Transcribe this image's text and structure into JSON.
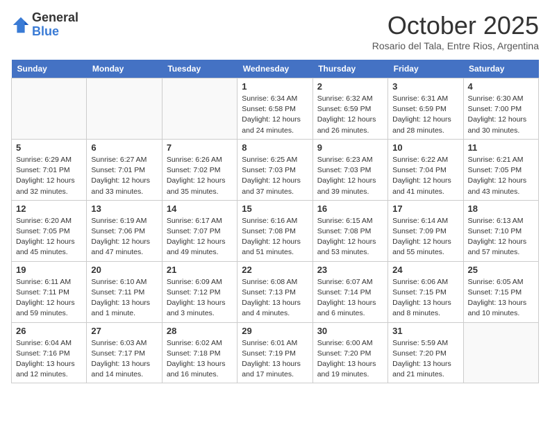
{
  "header": {
    "logo_line1": "General",
    "logo_line2": "Blue",
    "month": "October 2025",
    "location": "Rosario del Tala, Entre Rios, Argentina"
  },
  "days_of_week": [
    "Sunday",
    "Monday",
    "Tuesday",
    "Wednesday",
    "Thursday",
    "Friday",
    "Saturday"
  ],
  "weeks": [
    [
      {
        "day": "",
        "info": ""
      },
      {
        "day": "",
        "info": ""
      },
      {
        "day": "",
        "info": ""
      },
      {
        "day": "1",
        "info": "Sunrise: 6:34 AM\nSunset: 6:58 PM\nDaylight: 12 hours\nand 24 minutes."
      },
      {
        "day": "2",
        "info": "Sunrise: 6:32 AM\nSunset: 6:59 PM\nDaylight: 12 hours\nand 26 minutes."
      },
      {
        "day": "3",
        "info": "Sunrise: 6:31 AM\nSunset: 6:59 PM\nDaylight: 12 hours\nand 28 minutes."
      },
      {
        "day": "4",
        "info": "Sunrise: 6:30 AM\nSunset: 7:00 PM\nDaylight: 12 hours\nand 30 minutes."
      }
    ],
    [
      {
        "day": "5",
        "info": "Sunrise: 6:29 AM\nSunset: 7:01 PM\nDaylight: 12 hours\nand 32 minutes."
      },
      {
        "day": "6",
        "info": "Sunrise: 6:27 AM\nSunset: 7:01 PM\nDaylight: 12 hours\nand 33 minutes."
      },
      {
        "day": "7",
        "info": "Sunrise: 6:26 AM\nSunset: 7:02 PM\nDaylight: 12 hours\nand 35 minutes."
      },
      {
        "day": "8",
        "info": "Sunrise: 6:25 AM\nSunset: 7:03 PM\nDaylight: 12 hours\nand 37 minutes."
      },
      {
        "day": "9",
        "info": "Sunrise: 6:23 AM\nSunset: 7:03 PM\nDaylight: 12 hours\nand 39 minutes."
      },
      {
        "day": "10",
        "info": "Sunrise: 6:22 AM\nSunset: 7:04 PM\nDaylight: 12 hours\nand 41 minutes."
      },
      {
        "day": "11",
        "info": "Sunrise: 6:21 AM\nSunset: 7:05 PM\nDaylight: 12 hours\nand 43 minutes."
      }
    ],
    [
      {
        "day": "12",
        "info": "Sunrise: 6:20 AM\nSunset: 7:05 PM\nDaylight: 12 hours\nand 45 minutes."
      },
      {
        "day": "13",
        "info": "Sunrise: 6:19 AM\nSunset: 7:06 PM\nDaylight: 12 hours\nand 47 minutes."
      },
      {
        "day": "14",
        "info": "Sunrise: 6:17 AM\nSunset: 7:07 PM\nDaylight: 12 hours\nand 49 minutes."
      },
      {
        "day": "15",
        "info": "Sunrise: 6:16 AM\nSunset: 7:08 PM\nDaylight: 12 hours\nand 51 minutes."
      },
      {
        "day": "16",
        "info": "Sunrise: 6:15 AM\nSunset: 7:08 PM\nDaylight: 12 hours\nand 53 minutes."
      },
      {
        "day": "17",
        "info": "Sunrise: 6:14 AM\nSunset: 7:09 PM\nDaylight: 12 hours\nand 55 minutes."
      },
      {
        "day": "18",
        "info": "Sunrise: 6:13 AM\nSunset: 7:10 PM\nDaylight: 12 hours\nand 57 minutes."
      }
    ],
    [
      {
        "day": "19",
        "info": "Sunrise: 6:11 AM\nSunset: 7:11 PM\nDaylight: 12 hours\nand 59 minutes."
      },
      {
        "day": "20",
        "info": "Sunrise: 6:10 AM\nSunset: 7:11 PM\nDaylight: 13 hours\nand 1 minute."
      },
      {
        "day": "21",
        "info": "Sunrise: 6:09 AM\nSunset: 7:12 PM\nDaylight: 13 hours\nand 3 minutes."
      },
      {
        "day": "22",
        "info": "Sunrise: 6:08 AM\nSunset: 7:13 PM\nDaylight: 13 hours\nand 4 minutes."
      },
      {
        "day": "23",
        "info": "Sunrise: 6:07 AM\nSunset: 7:14 PM\nDaylight: 13 hours\nand 6 minutes."
      },
      {
        "day": "24",
        "info": "Sunrise: 6:06 AM\nSunset: 7:15 PM\nDaylight: 13 hours\nand 8 minutes."
      },
      {
        "day": "25",
        "info": "Sunrise: 6:05 AM\nSunset: 7:15 PM\nDaylight: 13 hours\nand 10 minutes."
      }
    ],
    [
      {
        "day": "26",
        "info": "Sunrise: 6:04 AM\nSunset: 7:16 PM\nDaylight: 13 hours\nand 12 minutes."
      },
      {
        "day": "27",
        "info": "Sunrise: 6:03 AM\nSunset: 7:17 PM\nDaylight: 13 hours\nand 14 minutes."
      },
      {
        "day": "28",
        "info": "Sunrise: 6:02 AM\nSunset: 7:18 PM\nDaylight: 13 hours\nand 16 minutes."
      },
      {
        "day": "29",
        "info": "Sunrise: 6:01 AM\nSunset: 7:19 PM\nDaylight: 13 hours\nand 17 minutes."
      },
      {
        "day": "30",
        "info": "Sunrise: 6:00 AM\nSunset: 7:20 PM\nDaylight: 13 hours\nand 19 minutes."
      },
      {
        "day": "31",
        "info": "Sunrise: 5:59 AM\nSunset: 7:20 PM\nDaylight: 13 hours\nand 21 minutes."
      },
      {
        "day": "",
        "info": ""
      }
    ]
  ]
}
